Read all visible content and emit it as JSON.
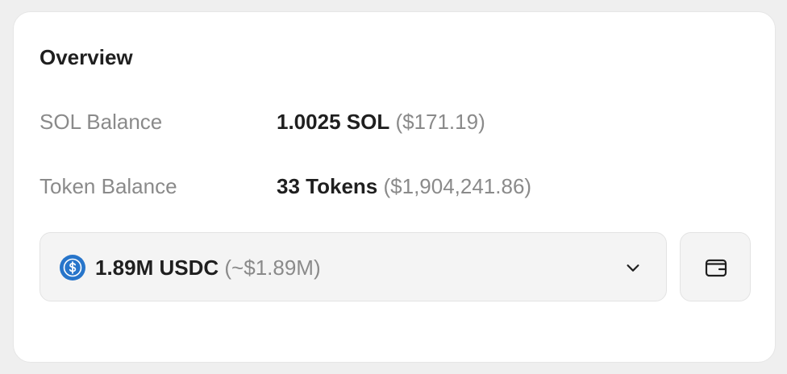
{
  "overview": {
    "title": "Overview",
    "sol_balance": {
      "label": "SOL Balance",
      "amount": "1.0025 SOL",
      "usd": "($171.19)"
    },
    "token_balance": {
      "label": "Token Balance",
      "count": "33 Tokens",
      "usd": "($1,904,241.86)"
    },
    "token_selector": {
      "icon": "usdc-coin-icon",
      "amount": "1.89M USDC",
      "usd": "(~$1.89M)",
      "dropdown_icon": "chevron-down-icon"
    },
    "wallet_button": {
      "icon": "wallet-icon"
    }
  },
  "colors": {
    "background": "#efefef",
    "card": "#ffffff",
    "text_primary": "#1f1f1f",
    "text_muted": "#8a8a8a",
    "control_bg": "#f4f4f4",
    "usdc_blue": "#2775ca"
  }
}
